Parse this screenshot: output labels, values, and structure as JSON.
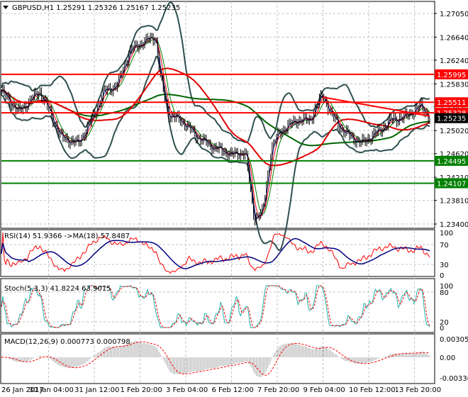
{
  "header": {
    "symbol": "GBPUSD,H1",
    "open": "1.25291",
    "high": "1.25326",
    "low": "1.25167",
    "close": "1.25235"
  },
  "chart_data": {
    "type": "line",
    "title": "GBPUSD,H1 1.25291 1.25326 1.25167 1.25235",
    "price_ticks": [
      "1.27050",
      "1.26640",
      "1.26240",
      "1.25830",
      "1.25430",
      "1.25020",
      "1.24620",
      "1.24210",
      "1.23810",
      "1.23400"
    ],
    "ylim": [
      1.234,
      1.2705
    ],
    "price_path": [
      [
        0,
        1.257
      ],
      [
        4,
        1.2535
      ],
      [
        9,
        1.257
      ],
      [
        14,
        1.249
      ],
      [
        18,
        1.248
      ],
      [
        21,
        1.252
      ],
      [
        24,
        1.257
      ],
      [
        27,
        1.258
      ],
      [
        30,
        1.264
      ],
      [
        33,
        1.2655
      ],
      [
        36,
        1.2665
      ],
      [
        37,
        1.26
      ],
      [
        39,
        1.253
      ],
      [
        42,
        1.252
      ],
      [
        46,
        1.249
      ],
      [
        49,
        1.2475
      ],
      [
        54,
        1.246
      ],
      [
        57,
        1.2465
      ],
      [
        59,
        1.235
      ],
      [
        61,
        1.236
      ],
      [
        63,
        1.247
      ],
      [
        65,
        1.25
      ],
      [
        69,
        1.252
      ],
      [
        72,
        1.252
      ],
      [
        75,
        1.2565
      ],
      [
        77,
        1.253
      ],
      [
        80,
        1.25
      ],
      [
        84,
        1.248
      ],
      [
        88,
        1.25
      ],
      [
        91,
        1.252
      ],
      [
        94,
        1.2525
      ],
      [
        98,
        1.2545
      ],
      [
        100,
        1.25235
      ]
    ],
    "levels": [
      {
        "label": "1.25995",
        "price": 1.25995,
        "color": "#ff0000"
      },
      {
        "label": "1.25511",
        "price": 1.25511,
        "color": "#ff0000"
      },
      {
        "label": "1.25328",
        "price": 1.25328,
        "color": "#ff0000"
      },
      {
        "label": "1.24495",
        "price": 1.24495,
        "color": "#008000"
      },
      {
        "label": "1.24107",
        "price": 1.24107,
        "color": "#008000"
      }
    ],
    "current_price": {
      "label": "1.25235",
      "price": 1.25235
    },
    "trendline": [
      [
        75,
        1.256
      ],
      [
        100,
        1.2527
      ]
    ],
    "time_labels": [
      "26 Jan 2017",
      "30 Jan 04:00",
      "31 Jan 12:00",
      "1 Feb 20:00",
      "3 Feb 04:00",
      "6 Feb 12:00",
      "7 Feb 20:00",
      "9 Feb 04:00",
      "10 Feb 12:00",
      "13 Feb 20:00"
    ],
    "rsi": {
      "title": "RSI(14) 51.9366  ->MA(18) 57.8487",
      "ticks": [
        "100",
        "70",
        "30",
        "0"
      ]
    },
    "stoch": {
      "title": "Stoch(5,3,3) 41.8224 63.9015",
      "ticks": [
        "100",
        "80",
        "20",
        "0"
      ]
    },
    "macd": {
      "title": "MACD(12,26,9) 0.000773 0.000798",
      "ticks": [
        "0.003059",
        "0.00",
        "-0.003366"
      ]
    }
  }
}
